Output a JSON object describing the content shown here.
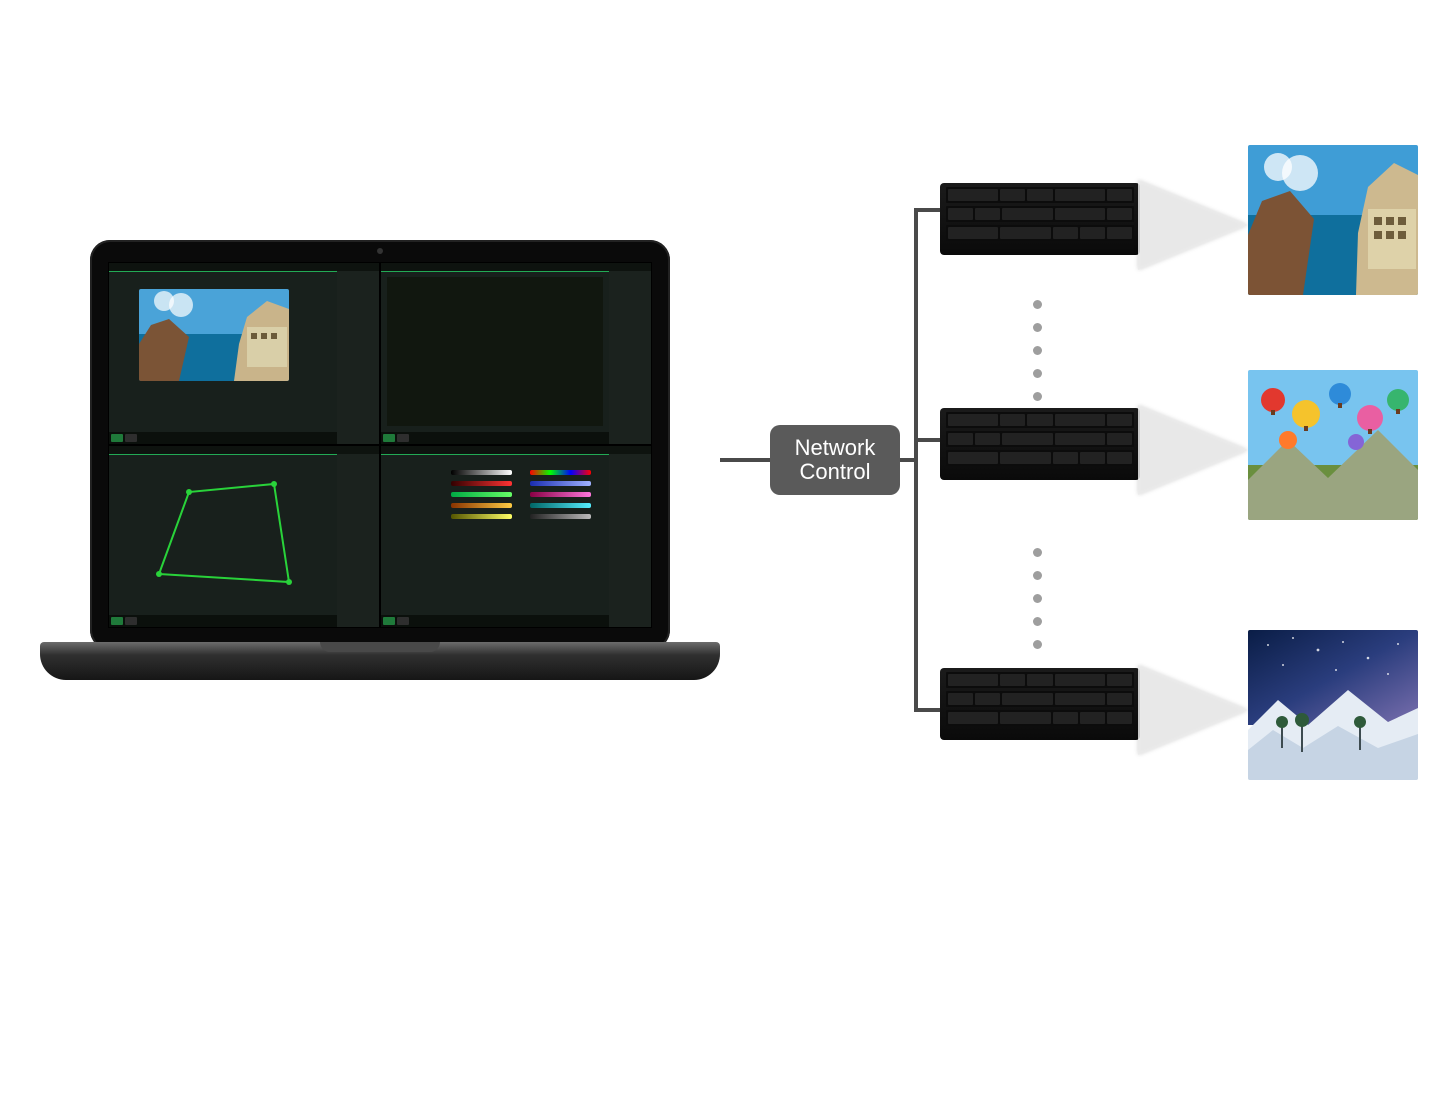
{
  "hub": {
    "label_line1": "Network",
    "label_line2": "Control"
  },
  "laptop": {
    "panels": {
      "preview": {
        "name": "image-preview-panel"
      },
      "timeline": {
        "name": "settings-panel"
      },
      "geometry": {
        "name": "geometry-correction-panel"
      },
      "color": {
        "name": "color-calibration-panel"
      }
    }
  },
  "projectors": [
    {
      "name": "projector-1",
      "scene": "coastal-town"
    },
    {
      "name": "projector-2",
      "scene": "hot-air-balloons"
    },
    {
      "name": "projector-3",
      "scene": "winter-milky-way"
    }
  ],
  "diagram": {
    "description": "Laptop running multi-panel projector-management software sends configuration over a Network Control hub to multiple projectors, each rendering a different image."
  }
}
